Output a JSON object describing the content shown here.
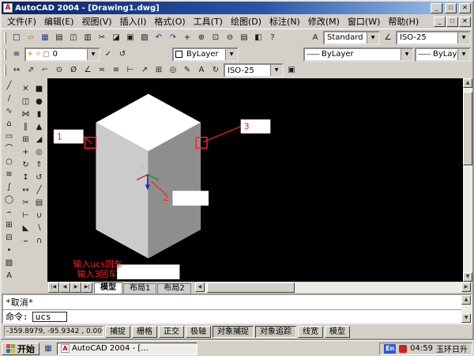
{
  "ui": {
    "dropdown": "▼",
    "up": "▲",
    "down": "▼",
    "left": "◀",
    "right": "▶"
  },
  "window": {
    "title": "AutoCAD 2004 - [Drawing1.dwg]",
    "icon_letter": "A",
    "controls": {
      "minimize": "_",
      "maximize": "□",
      "close": "✕"
    }
  },
  "menubar": {
    "items": [
      {
        "name": "menu-file",
        "label": "文件(F)"
      },
      {
        "name": "menu-edit",
        "label": "编辑(E)"
      },
      {
        "name": "menu-view",
        "label": "视图(V)"
      },
      {
        "name": "menu-insert",
        "label": "插入(I)"
      },
      {
        "name": "menu-format",
        "label": "格式(O)"
      },
      {
        "name": "menu-tools",
        "label": "工具(T)"
      },
      {
        "name": "menu-draw",
        "label": "绘图(D)"
      },
      {
        "name": "menu-dimension",
        "label": "标注(N)"
      },
      {
        "name": "menu-modify",
        "label": "修改(M)"
      },
      {
        "name": "menu-window",
        "label": "窗口(W)"
      },
      {
        "name": "menu-help",
        "label": "帮助(H)"
      }
    ]
  },
  "toolbars": {
    "standard": {
      "icons": [
        {
          "name": "new-icon",
          "glyph": "□"
        },
        {
          "name": "open-icon",
          "glyph": "▱",
          "color": "#a07800"
        },
        {
          "name": "save-icon",
          "glyph": "▦",
          "color": "#27408b"
        },
        {
          "name": "plot-icon",
          "glyph": "▤"
        },
        {
          "name": "plot-preview-icon",
          "glyph": "◫"
        },
        {
          "name": "publish-icon",
          "glyph": "▥"
        },
        {
          "name": "cut-icon",
          "glyph": "✂"
        },
        {
          "name": "copy-icon",
          "glyph": "◪"
        },
        {
          "name": "paste-icon",
          "glyph": "▣"
        },
        {
          "name": "match-properties-icon",
          "glyph": "▨"
        },
        {
          "name": "undo-icon",
          "glyph": "↶",
          "color": "#27408b"
        },
        {
          "name": "redo-icon",
          "glyph": "↷",
          "color": "#27408b"
        },
        {
          "name": "pan-icon",
          "glyph": "+"
        },
        {
          "name": "zoom-realtime-icon",
          "glyph": "⊕"
        },
        {
          "name": "zoom-window-icon",
          "glyph": "⊡"
        },
        {
          "name": "zoom-previous-icon",
          "glyph": "⊖"
        },
        {
          "name": "properties-icon",
          "glyph": "▤"
        },
        {
          "name": "designcenter-icon",
          "glyph": "◧"
        },
        {
          "name": "help-icon",
          "glyph": "?"
        }
      ]
    },
    "styles": {
      "text_style_icon": "A",
      "text_style_value": "Standard",
      "dim_style_icon": "∠",
      "dim_style_value": "ISO-25"
    },
    "layers": {
      "layer_properties_icon": "≡",
      "layer_state_icons": [
        {
          "name": "layer-on-icon",
          "glyph": "☀",
          "color": "#c8a000"
        },
        {
          "name": "layer-freeze-icon",
          "glyph": "☼",
          "color": "#c8a000"
        },
        {
          "name": "layer-lock-icon",
          "glyph": "▢",
          "color": "#606060"
        }
      ],
      "layer_value": "0",
      "after_icons": [
        {
          "name": "make-object-layer-current-icon",
          "glyph": "✓"
        },
        {
          "name": "layer-previous-icon",
          "glyph": "↺"
        }
      ]
    },
    "properties": {
      "swatch_color": "#ffffff",
      "color_value": "ByLayer",
      "linetype_sample": "——",
      "linetype_value": "ByLayer",
      "lineweight_sample": "——",
      "lineweight_value": "ByLayer"
    },
    "dimension": {
      "icons": [
        {
          "name": "dim-linear-icon",
          "glyph": "↔"
        },
        {
          "name": "dim-aligned-icon",
          "glyph": "⇗"
        },
        {
          "name": "dim-ordinate-icon",
          "glyph": "⌐"
        },
        {
          "name": "dim-radius-icon",
          "glyph": "⊙"
        },
        {
          "name": "dim-diameter-icon",
          "glyph": "Ø"
        },
        {
          "name": "dim-angular-icon",
          "glyph": "∠"
        },
        {
          "name": "quick-dimension-icon",
          "glyph": "≍"
        },
        {
          "name": "dim-baseline-icon",
          "glyph": "≡"
        },
        {
          "name": "dim-continue-icon",
          "glyph": "⊢"
        },
        {
          "name": "quick-leader-icon",
          "glyph": "↗"
        },
        {
          "name": "tolerance-icon",
          "glyph": "⊞"
        },
        {
          "name": "center-mark-icon",
          "glyph": "◎"
        },
        {
          "name": "dim-edit-icon",
          "glyph": "✎"
        },
        {
          "name": "dim-text-edit-icon",
          "glyph": "A"
        },
        {
          "name": "dim-update-icon",
          "glyph": "↻"
        }
      ],
      "style_value": "ISO-25",
      "trailing_icon": [
        {
          "name": "dim-style-manager-icon",
          "glyph": "▣"
        }
      ]
    },
    "draw": {
      "icons": [
        {
          "name": "line-icon",
          "glyph": "╱"
        },
        {
          "name": "construction-line-icon",
          "glyph": "∕"
        },
        {
          "name": "polyline-icon",
          "glyph": "∿"
        },
        {
          "name": "polygon-icon",
          "glyph": "⌂"
        },
        {
          "name": "rectangle-icon",
          "glyph": "▭"
        },
        {
          "name": "arc-icon",
          "glyph": "⌒"
        },
        {
          "name": "circle-icon",
          "glyph": "○"
        },
        {
          "name": "revision-cloud-icon",
          "glyph": "≋"
        },
        {
          "name": "spline-icon",
          "glyph": "∫"
        },
        {
          "name": "ellipse-icon",
          "glyph": "◯"
        },
        {
          "name": "ellipse-arc-icon",
          "glyph": "⌢"
        },
        {
          "name": "insert-block-icon",
          "glyph": "⊞"
        },
        {
          "name": "make-block-icon",
          "glyph": "⊟"
        },
        {
          "name": "point-icon",
          "glyph": "•"
        },
        {
          "name": "hatch-icon",
          "glyph": "▨"
        },
        {
          "name": "multiline-text-icon",
          "glyph": "A"
        }
      ]
    },
    "modify_solids": {
      "icons": [
        {
          "name": "erase-icon",
          "glyph": "✕"
        },
        {
          "name": "solid-box-icon",
          "glyph": "■"
        },
        {
          "name": "copy-object-icon",
          "glyph": "◫"
        },
        {
          "name": "solid-sphere-icon",
          "glyph": "●"
        },
        {
          "name": "mirror-icon",
          "glyph": "⋈"
        },
        {
          "name": "solid-cylinder-icon",
          "glyph": "▮"
        },
        {
          "name": "offset-icon",
          "glyph": "∥"
        },
        {
          "name": "solid-cone-icon",
          "glyph": "▲"
        },
        {
          "name": "array-icon",
          "glyph": "⊞"
        },
        {
          "name": "solid-wedge-icon",
          "glyph": "◢"
        },
        {
          "name": "move-icon",
          "glyph": "+"
        },
        {
          "name": "solid-torus-icon",
          "glyph": "◎"
        },
        {
          "name": "rotate-icon",
          "glyph": "↻"
        },
        {
          "name": "extrude-icon",
          "glyph": "⇑"
        },
        {
          "name": "scale-icon",
          "glyph": "↕"
        },
        {
          "name": "revolve-icon",
          "glyph": "↺"
        },
        {
          "name": "stretch-icon",
          "glyph": "↔"
        },
        {
          "name": "slice-icon",
          "glyph": "╱"
        },
        {
          "name": "trim-icon",
          "glyph": "✂"
        },
        {
          "name": "section-icon",
          "glyph": "▤"
        },
        {
          "name": "extend-icon",
          "glyph": "⊢"
        },
        {
          "name": "union-icon",
          "glyph": "∪"
        },
        {
          "name": "chamfer-icon",
          "glyph": "◣"
        },
        {
          "name": "subtract-icon",
          "glyph": "∖"
        },
        {
          "name": "fillet-icon",
          "glyph": "⌣"
        },
        {
          "name": "intersect-icon",
          "glyph": "∩"
        }
      ]
    }
  },
  "canvas": {
    "labels": {
      "marker1": "1",
      "marker2": "2",
      "marker3": "3"
    },
    "annotation_text_1": "输入ucs回车",
    "annotation_text_2": "输入3回车",
    "colors": {
      "background": "#000000",
      "cube_top": "#ffffff",
      "cube_left": "#cbcbcb",
      "cube_right": "#8e8e8e",
      "annotation": "#ff2020",
      "axis_x": "#cc2222",
      "axis_y": "#00a000",
      "axis_z": "#2222cc"
    }
  },
  "tabs": {
    "nav": [
      "|◀",
      "◀",
      "▶",
      "▶|"
    ],
    "items": [
      {
        "name": "tab-model",
        "label": "模型",
        "active": true
      },
      {
        "name": "tab-layout1",
        "label": "布局1",
        "active": false
      },
      {
        "name": "tab-layout2",
        "label": "布局2",
        "active": false
      }
    ]
  },
  "command": {
    "history_line": "*取消*",
    "prompt": "命令:",
    "input_value": "ucs"
  },
  "statusbar": {
    "coordinates": "-359.8979, -95.9342 ,  0.0000",
    "buttons": [
      {
        "name": "status-snap-button",
        "label": "捕捉",
        "pressed": false
      },
      {
        "name": "status-grid-button",
        "label": "栅格",
        "pressed": false
      },
      {
        "name": "status-ortho-button",
        "label": "正交",
        "pressed": false
      },
      {
        "name": "status-polar-button",
        "label": "极轴",
        "pressed": false
      },
      {
        "name": "status-osnap-button",
        "label": "对象捕捉",
        "pressed": true
      },
      {
        "name": "status-otrack-button",
        "label": "对象追踪",
        "pressed": true
      },
      {
        "name": "status-lineweight-button",
        "label": "线宽",
        "pressed": false
      },
      {
        "name": "status-model-button",
        "label": "模型",
        "pressed": false
      }
    ]
  },
  "taskbar": {
    "start_label": "开始",
    "quick_launch": [
      {
        "name": "quick-launch-desktop-icon",
        "glyph": "▦",
        "color": "#27408b"
      }
    ],
    "task_label": "AutoCAD 2004 - [...",
    "task_icon_letter": "A",
    "tray": {
      "input_indicator": "En",
      "time": "04:59",
      "vendor_text": "玉环日升"
    }
  }
}
